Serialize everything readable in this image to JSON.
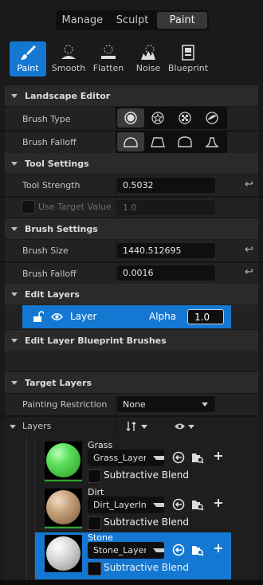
{
  "modes": [
    {
      "label": "Manage",
      "active": false
    },
    {
      "label": "Sculpt",
      "active": false
    },
    {
      "label": "Paint",
      "active": true
    }
  ],
  "tools": [
    {
      "label": "Paint",
      "icon": "paintbrush-icon",
      "active": true
    },
    {
      "label": "Smooth",
      "icon": "smooth-icon",
      "active": false
    },
    {
      "label": "Flatten",
      "icon": "flatten-icon",
      "active": false
    },
    {
      "label": "Noise",
      "icon": "noise-icon",
      "active": false
    },
    {
      "label": "Blueprint",
      "icon": "blueprint-icon",
      "active": false
    }
  ],
  "landscape_editor": {
    "title": "Landscape Editor",
    "brush_type_label": "Brush Type",
    "brush_falloff_label": "Brush Falloff",
    "brush_types": [
      "circle-brush-icon",
      "alpha-brush-icon",
      "pattern-brush-icon",
      "component-brush-icon"
    ],
    "brush_type_selected": 0,
    "falloff_types": [
      "smooth-falloff-icon",
      "linear-falloff-icon",
      "spherical-falloff-icon",
      "tip-falloff-icon"
    ],
    "falloff_selected": 0
  },
  "tool_settings": {
    "title": "Tool Settings",
    "tool_strength_label": "Tool Strength",
    "tool_strength_value": "0.5032",
    "use_target_value_label": "Use Target Value",
    "target_value": "1.0"
  },
  "brush_settings": {
    "title": "Brush Settings",
    "brush_size_label": "Brush Size",
    "brush_size_value": "1440.512695",
    "brush_falloff_label": "Brush Falloff",
    "brush_falloff_value": "0.0016"
  },
  "edit_layers": {
    "title": "Edit Layers",
    "layer_name": "Layer",
    "alpha_label": "Alpha",
    "alpha_value": "1.0"
  },
  "edit_layer_bp": {
    "title": "Edit Layer Blueprint Brushes"
  },
  "target_layers": {
    "title": "Target Layers",
    "painting_restriction_label": "Painting Restriction",
    "painting_restriction_value": "None",
    "layers_label": "Layers",
    "items": [
      {
        "name": "Grass",
        "layerinfo": "Grass_LayerInfo",
        "subtractive_label": "Subtractive Blend",
        "color": "#4ccf4c",
        "selected": false
      },
      {
        "name": "Dirt",
        "layerinfo": "Dirt_LayerInfo",
        "subtractive_label": "Subtractive Blend",
        "color": "#b48e68",
        "selected": false
      },
      {
        "name": "Stone",
        "layerinfo": "Stone_LayerInfo",
        "subtractive_label": "Subtractive Blend",
        "color": "#cfcfcf",
        "selected": true
      }
    ]
  },
  "colors": {
    "accent": "#1478d2",
    "panel": "#222222",
    "header": "#2a2a2a"
  }
}
